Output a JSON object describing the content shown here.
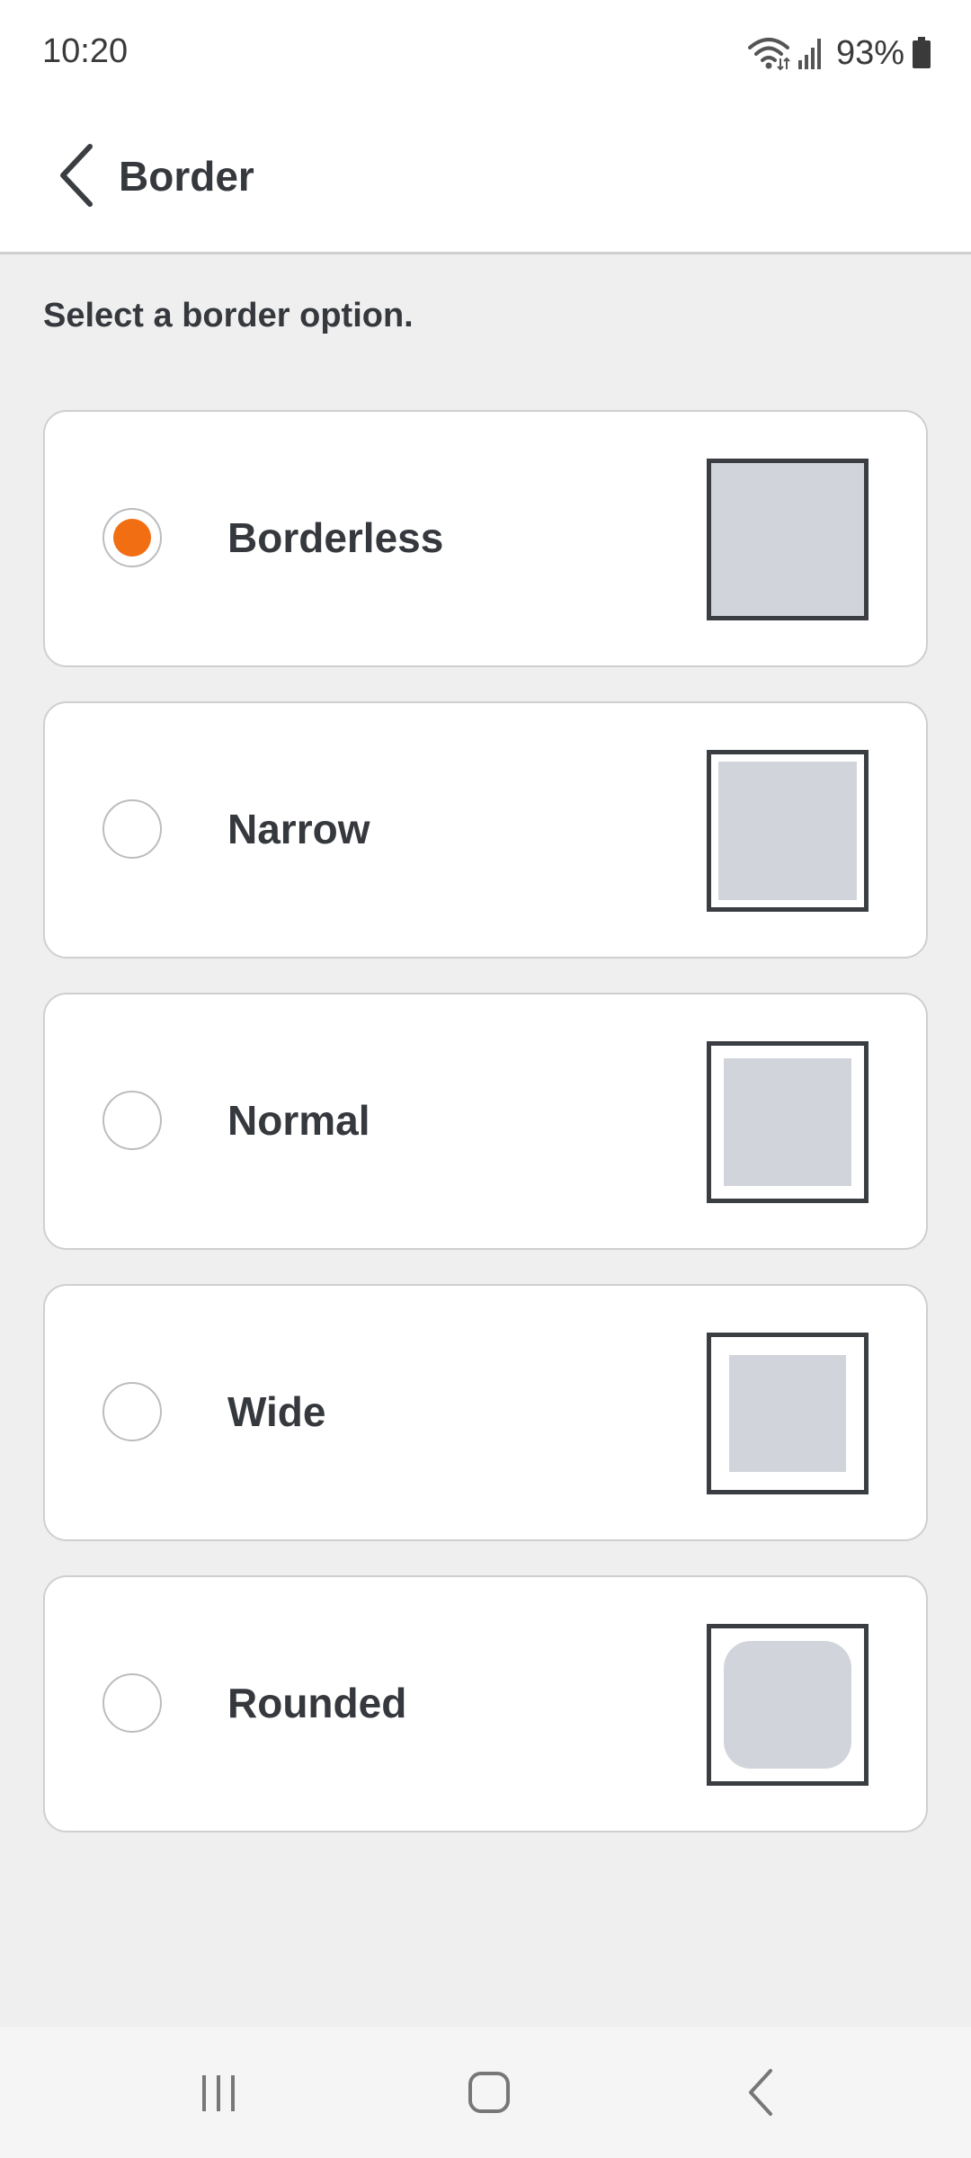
{
  "status_bar": {
    "time": "10:20",
    "battery": "93%",
    "icons": [
      "wifi-icon",
      "signal-icon",
      "battery-icon"
    ]
  },
  "app_bar": {
    "title": "Border",
    "back_icon": "chevron-left-icon"
  },
  "instruction": "Select a border option.",
  "options": [
    {
      "label": "Borderless",
      "selected": true,
      "preview": "borderless"
    },
    {
      "label": "Narrow",
      "selected": false,
      "preview": "narrow"
    },
    {
      "label": "Normal",
      "selected": false,
      "preview": "normal"
    },
    {
      "label": "Wide",
      "selected": false,
      "preview": "wide"
    },
    {
      "label": "Rounded",
      "selected": false,
      "preview": "rounded"
    }
  ],
  "colors": {
    "accent": "#f26e12",
    "text": "#35383d",
    "background": "#efefef",
    "preview_fill": "#d1d5db"
  },
  "nav_bar": {
    "buttons": [
      "recents-icon",
      "home-icon",
      "back-icon"
    ]
  }
}
